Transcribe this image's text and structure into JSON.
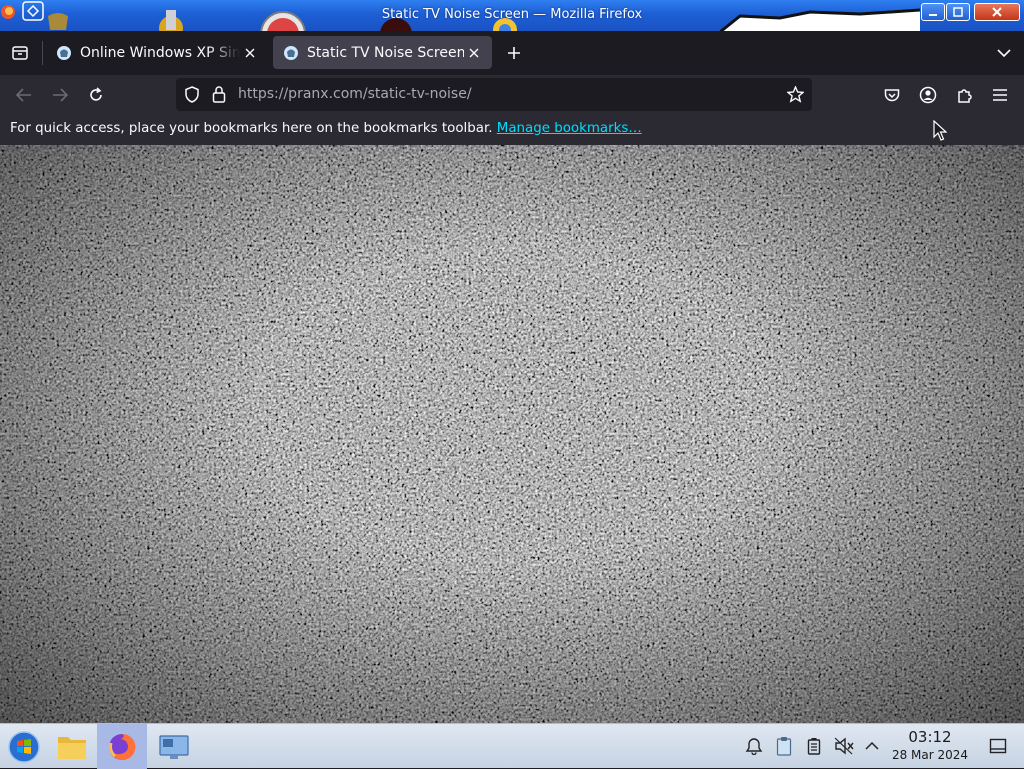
{
  "window": {
    "title": "Static TV Noise Screen — Mozilla Firefox"
  },
  "tabs": [
    {
      "label": "Online Windows XP Simu",
      "favicon": "pranx-favicon-icon",
      "active": false
    },
    {
      "label": "Static TV Noise Screen",
      "favicon": "pranx-favicon-icon",
      "active": true
    }
  ],
  "urlbar": {
    "url_host": "https://pranx.com",
    "url_path": "/static-tv-noise/"
  },
  "bookmarks_toolbar": {
    "message": "For quick access, place your bookmarks here on the bookmarks toolbar.",
    "link_label": "Manage bookmarks…"
  },
  "content": {
    "description_icon": "tv-static-noise"
  },
  "taskbar": {
    "clock_time": "03:12",
    "clock_date": "28 Mar 2024",
    "pinned": [
      "start-icon",
      "file-manager-icon",
      "firefox-icon",
      "system-settings-icon"
    ],
    "tray": [
      "notifications-icon",
      "clipboard-icon",
      "battery-icon",
      "volume-muted-icon",
      "expand-tray-icon",
      "show-desktop-icon"
    ]
  },
  "colors": {
    "titlebar": "#1d5fd4",
    "tabstrip": "#1c1b22",
    "toolbar": "#2b2a33",
    "active_tab": "#42414d",
    "link": "#00ddff",
    "taskbar": "#c6d3e3"
  }
}
